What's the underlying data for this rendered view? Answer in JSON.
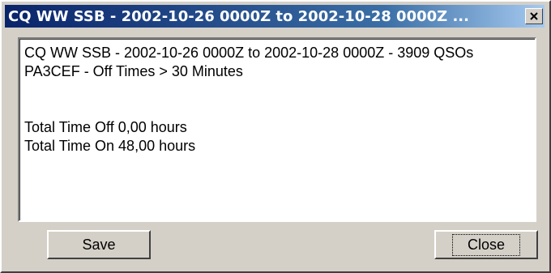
{
  "window": {
    "title": "CQ WW SSB - 2002-10-26 0000Z to 2002-10-28 0000Z ...",
    "close_icon": "close-icon"
  },
  "report": {
    "lines": [
      "CQ WW SSB - 2002-10-26 0000Z to 2002-10-28 0000Z - 3909 QSOs",
      "PA3CEF - Off Times > 30 Minutes",
      "",
      "",
      "Total Time Off 0,00 hours",
      "Total Time On 48,00 hours"
    ]
  },
  "buttons": {
    "save_label": "Save",
    "close_label": "Close"
  },
  "colors": {
    "titlebar_start": "#0a246a",
    "titlebar_end": "#a6caf0",
    "face": "#d4d0c8"
  }
}
